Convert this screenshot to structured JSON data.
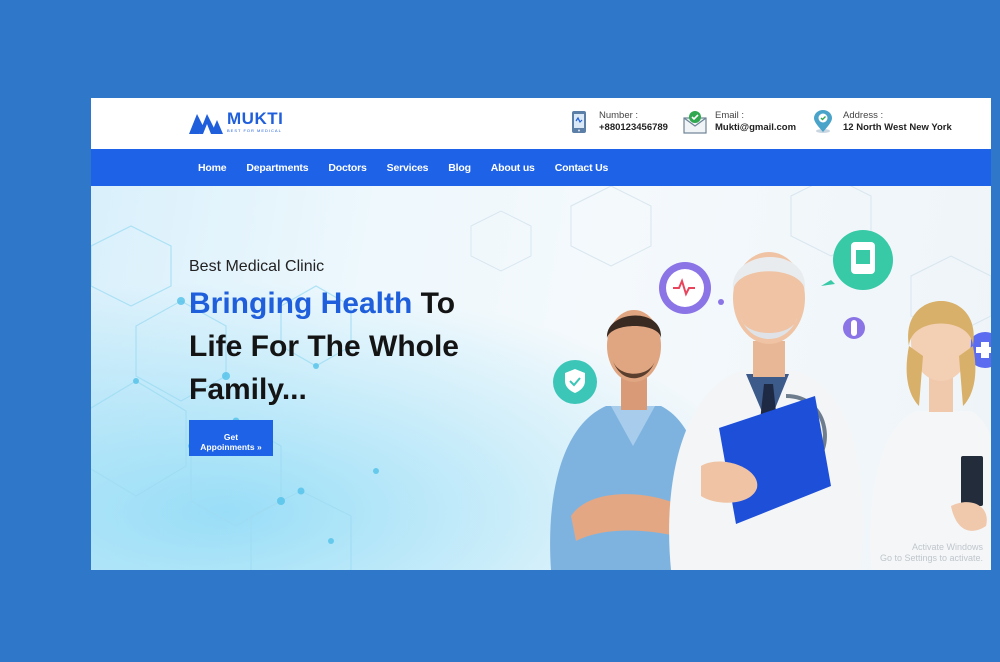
{
  "brand": {
    "name": "MUKTI",
    "tagline": "BEST FOR MEDICAL",
    "color": "#1f5fdc"
  },
  "contacts": [
    {
      "icon": "phone-icon",
      "label": "Number :",
      "value": "+880123456789"
    },
    {
      "icon": "email-icon",
      "label": "Email :",
      "value": "Mukti@gmail.com"
    },
    {
      "icon": "location-pin-icon",
      "label": "Address :",
      "value": "12 North West New York"
    }
  ],
  "nav": {
    "color": "#1e62e8",
    "items": [
      "Home",
      "Departments",
      "Doctors",
      "Services",
      "Blog",
      "About us",
      "Contact Us"
    ]
  },
  "hero": {
    "eyebrow": "Best Medical Clinic",
    "headline_blue": "Bringing Health",
    "headline_rest": " To Life For The Whole Family...",
    "cta_line1": "Get",
    "cta_line2": "Appoinments »",
    "floating_icons": [
      "heart-pulse-icon",
      "shield-check-icon",
      "iv-bag-icon",
      "medkit-icon",
      "pill-icon"
    ],
    "watermark_line1": "Activate Windows",
    "watermark_line2": "Go to Settings to activate."
  }
}
